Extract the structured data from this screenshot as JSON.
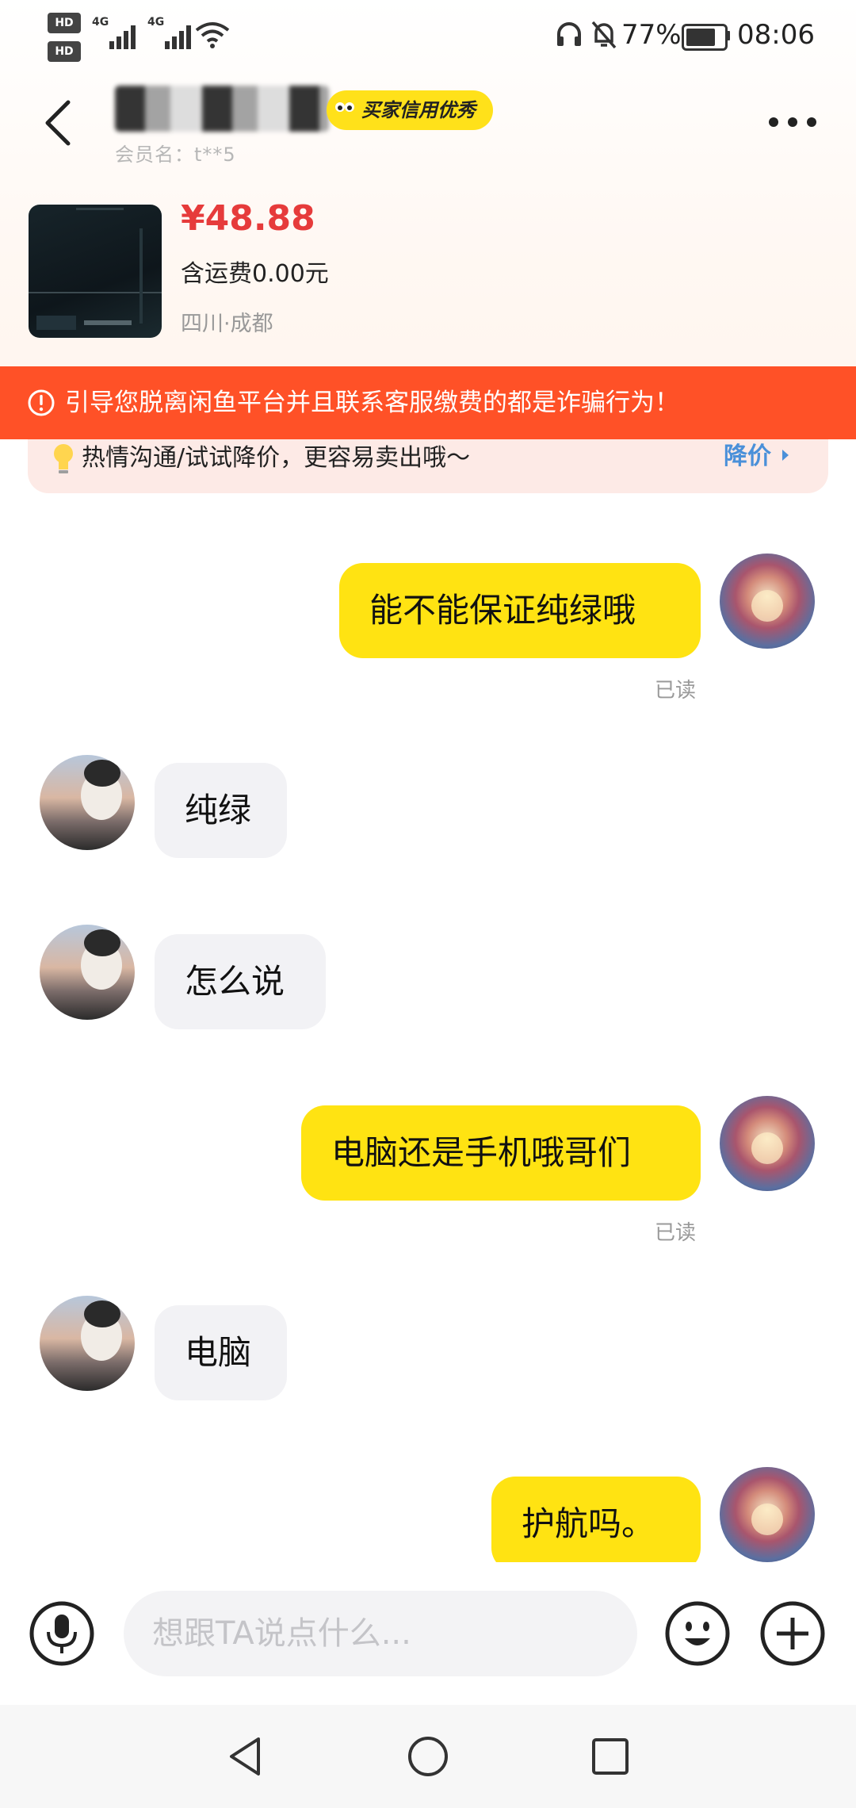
{
  "status_bar": {
    "hd1": "HD",
    "hd2": "HD",
    "net1": "4G",
    "net2": "4G",
    "battery": "77%",
    "time": "08:06"
  },
  "header": {
    "credit_badge": "买家信用优秀",
    "member_text": "会员名：t**5"
  },
  "product": {
    "price": "¥48.88",
    "shipping": "含运费0.00元",
    "location": "四川·成都"
  },
  "warning": {
    "text": "引导您脱离闲鱼平台并且联系客服缴费的都是诈骗行为！"
  },
  "tip": {
    "text": "热情沟通/试试降价，更容易卖出哦～",
    "action": "降价"
  },
  "messages": [
    {
      "from": "me",
      "text": "能不能保证纯绿哦",
      "status": "已读"
    },
    {
      "from": "other",
      "text": "纯绿"
    },
    {
      "from": "other",
      "text": "怎么说"
    },
    {
      "from": "me",
      "text": "电脑还是手机哦哥们",
      "status": "已读"
    },
    {
      "from": "other",
      "text": "电脑"
    },
    {
      "from": "me",
      "text": "护航吗。"
    }
  ],
  "input": {
    "placeholder": "想跟TA说点什么..."
  },
  "colors": {
    "accent_yellow": "#ffe312",
    "warning_red": "#ff5127",
    "price_red": "#e63b3b",
    "link_blue": "#4a90d9"
  }
}
